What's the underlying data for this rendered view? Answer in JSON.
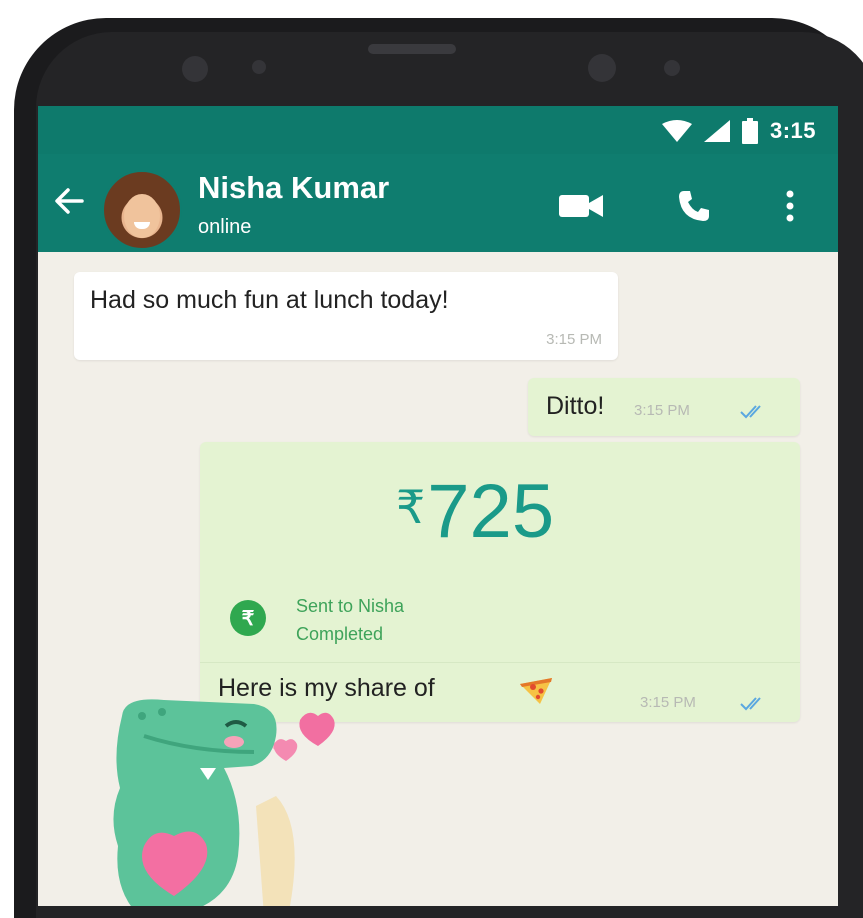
{
  "status_bar": {
    "time": "3:15",
    "icons": [
      "wifi-icon",
      "signal-icon",
      "battery-icon"
    ]
  },
  "header": {
    "contact_name": "Nisha Kumar",
    "presence": "online",
    "actions": [
      "video-call-icon",
      "voice-call-icon",
      "more-options-icon"
    ]
  },
  "messages": [
    {
      "direction": "incoming",
      "text": "Had so much fun at lunch today!",
      "time": "3:15 PM"
    },
    {
      "direction": "outgoing",
      "text": "Ditto!",
      "time": "3:15 PM",
      "ticks": "read"
    },
    {
      "direction": "outgoing",
      "type": "payment",
      "currency_symbol": "₹",
      "amount": "725",
      "status_line_1": "Sent to Nisha",
      "status_line_2": "Completed",
      "caption": "Here is my share of",
      "caption_emoji": "pizza-icon",
      "time": "3:15 PM",
      "ticks": "read"
    },
    {
      "direction": "incoming",
      "type": "sticker",
      "sticker": "dinosaur-hearts-sticker"
    }
  ],
  "colors": {
    "header": "#0f7d6f",
    "outgoing_bubble": "#e4f3d2",
    "incoming_bubble": "#ffffff",
    "amount": "#1a9a89",
    "payment_badge": "#2fa84f",
    "read_ticks": "#5aa7e0"
  }
}
